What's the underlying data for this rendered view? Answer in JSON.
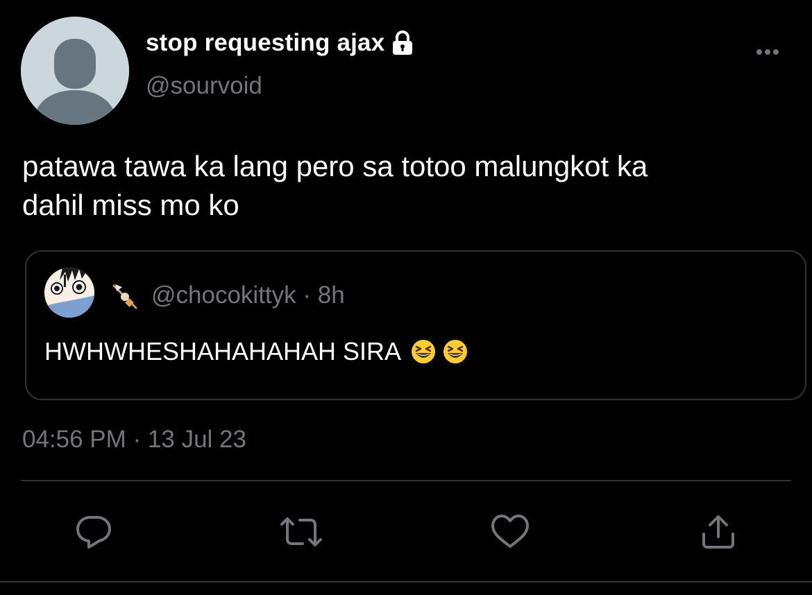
{
  "author": {
    "display_name": "stop requesting ajax",
    "handle": "@sourvoid",
    "protected": true
  },
  "tweet": {
    "text": "patawa tawa ka lang pero sa totoo malungkot ka\ndahil miss mo ko",
    "timestamp": "04:56 PM · 13 Jul 23"
  },
  "quoted_tweet": {
    "meta": "@chocokittyk · 8h",
    "text": "HWHWHESHAHAHAHAH SIRA",
    "emojis": [
      "grinning-squinting-face",
      "grinning-squinting-face"
    ],
    "badge_icon": "oden-skewer-icon"
  },
  "actions": [
    {
      "name": "reply",
      "icon": "reply-icon"
    },
    {
      "name": "retweet",
      "icon": "retweet-icon"
    },
    {
      "name": "like",
      "icon": "heart-icon"
    },
    {
      "name": "share",
      "icon": "share-icon"
    }
  ],
  "colors": {
    "background": "#000000",
    "primary_text": "#ffffff",
    "secondary_text": "#71767b",
    "border": "#2f3336",
    "avatar_bg": "#ccd6dd",
    "avatar_fg": "#66757f"
  }
}
